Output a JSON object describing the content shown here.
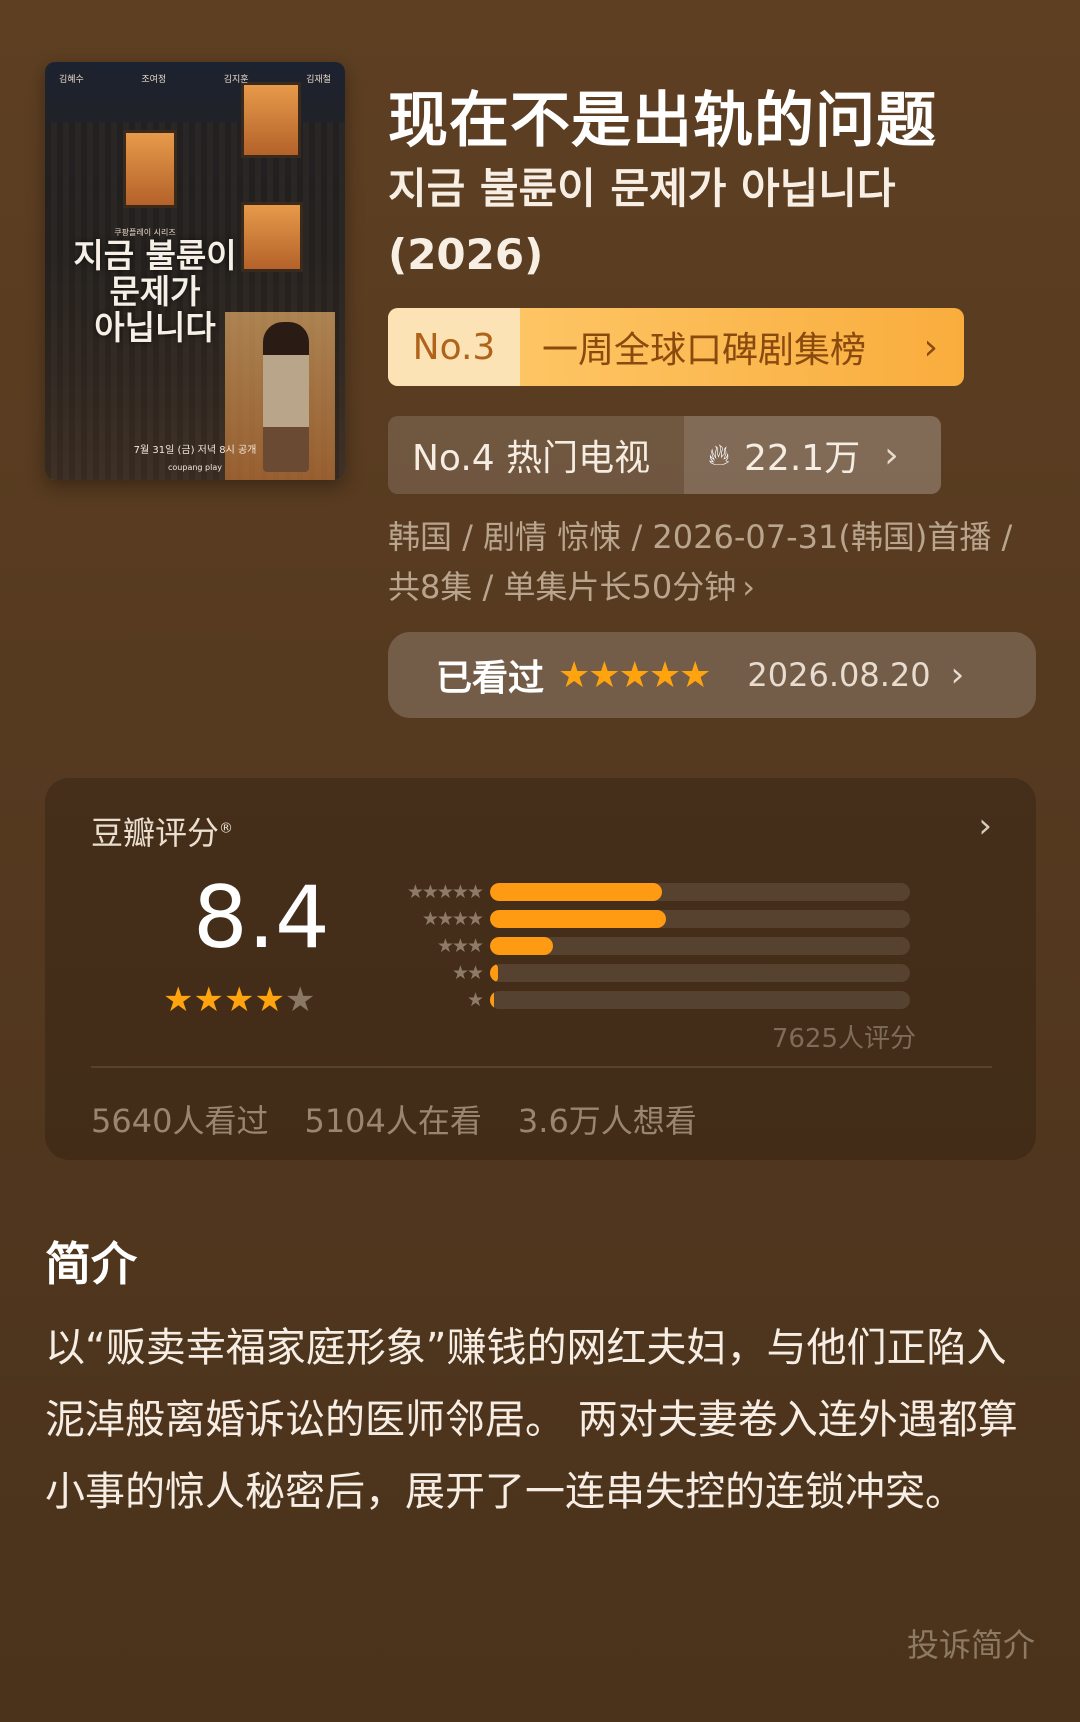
{
  "poster": {
    "cast": [
      "김혜수",
      "조여정",
      "김지훈",
      "김재철"
    ],
    "series_label": "쿠팡플레이 시리즈",
    "title_ko": "지금 불륜이\n문제가\n아닙니다",
    "release": "7월 31일 (금) 저녁 8시 공개",
    "brand": "coupang play"
  },
  "header": {
    "title": "现在不是出轨的问题",
    "subtitle": "지금 불륜이 문제가 아닙니다 (2026)"
  },
  "rank_primary": {
    "no": "No.3",
    "label": "一周全球口碑剧集榜"
  },
  "rank_secondary": {
    "no": "No.4 热门电视",
    "heat": "22.1万"
  },
  "meta": {
    "line": "韩国 / 剧情 惊悚 / 2026-07-31(韩国)首播 / 共8集 / 单集片长50分钟"
  },
  "watched": {
    "label": "已看过",
    "stars": 5,
    "date": "2026.08.20"
  },
  "rating": {
    "title": "豆瓣评分",
    "mark": "®",
    "score": "8.4",
    "stars_filled": 4,
    "distribution": [
      {
        "stars": 5,
        "fraction": 0.41
      },
      {
        "stars": 4,
        "fraction": 0.42
      },
      {
        "stars": 3,
        "fraction": 0.15
      },
      {
        "stars": 2,
        "fraction": 0.02
      },
      {
        "stars": 1,
        "fraction": 0.01
      }
    ],
    "count": "7625人评分",
    "watched": "5640人看过",
    "watching": "5104人在看",
    "want": "3.6万人想看"
  },
  "intro": {
    "heading": "简介",
    "text": "以“贩卖幸福家庭形象”赚钱的网红夫妇，与他们正陷入泥淖般离婚诉讼的医师邻居。 两对夫妻卷入连外遇都算小事的惊人秘密后，展开了一连串失控的连锁冲突。",
    "report": "投诉简介"
  },
  "colors": {
    "accent": "#ffa40f",
    "background": "#5e3f22"
  }
}
